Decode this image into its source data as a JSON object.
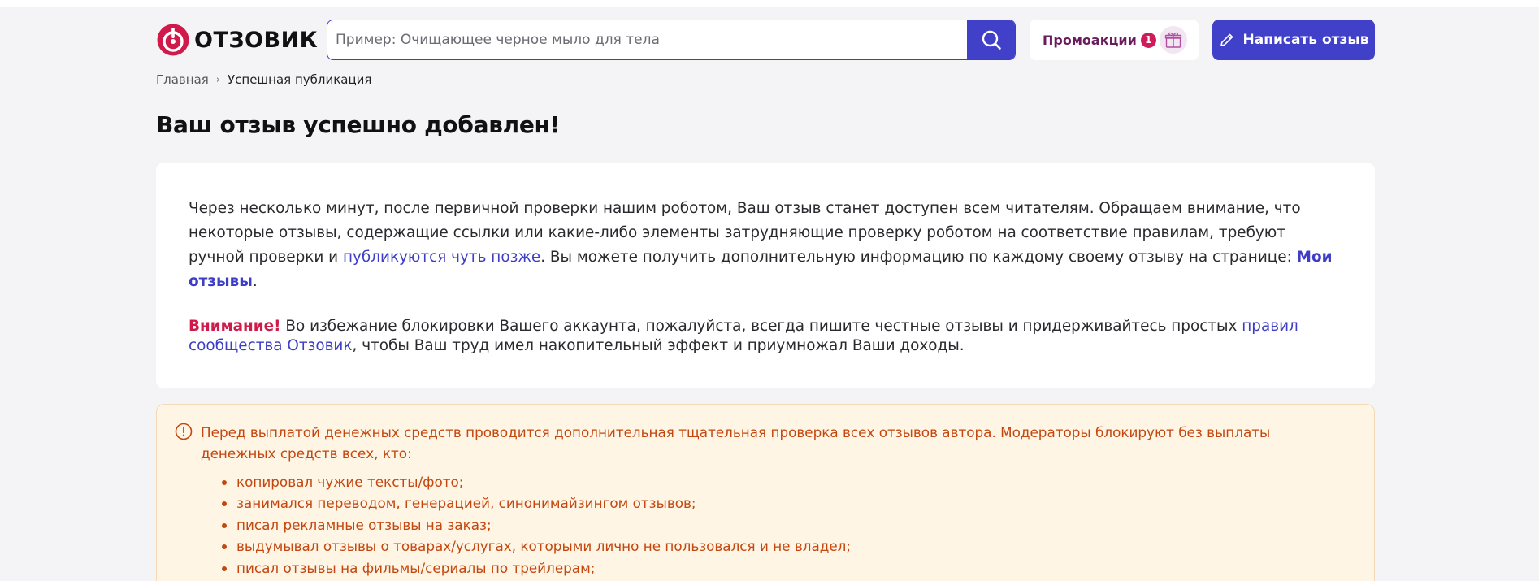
{
  "header": {
    "logo_text": "ОТЗОВИК",
    "search": {
      "placeholder": "Пример: Очищающее черное мыло для тела",
      "value": ""
    },
    "promo": {
      "label": "Промоакции",
      "badge": "1"
    },
    "write_button": "Написать отзыв",
    "colors": {
      "brand": "#d01b4a",
      "accent": "#4040c8"
    }
  },
  "breadcrumb": {
    "home": "Главная",
    "separator": "›",
    "current": "Успешная публикация"
  },
  "page_title": "Ваш отзыв успешно добавлен!",
  "success_card": {
    "intro": "Через несколько минут, после первичной проверки нашим роботом, Ваш отзыв станет доступен всем читателям. Обращаем внимание, что некоторые отзывы, содержащие ссылки или какие-либо элементы затрудняющие проверку роботом на соответствие правилам, требуют ручной проверки и ",
    "later_link": "публикуются чуть позже",
    "more_info": ". Вы можете получить дополнительную информацию по каждому своему отзыву на странице: ",
    "my_reviews_link": "Мои отзывы",
    "period": ".",
    "attention_label": "Внимание!",
    "attention_text": " Во избежание блокировки Вашего аккаунта, пожалуйста, всегда пишите честные отзывы и придерживайтесь простых ",
    "rules_link": "правил сообщества Отзовик",
    "attention_tail": ", чтобы Ваш труд имел накопительный эффект и приумножал Ваши доходы."
  },
  "notice": {
    "icon": "exclamation-circle-icon",
    "text": "Перед выплатой денежных средств проводится дополнительная тщательная проверка всех отзывов автора. Модераторы блокируют без выплаты денежных средств всех, кто:",
    "items": [
      "копировал чужие тексты/фото;",
      "занимался переводом, генерацией, синонимайзингом отзывов;",
      "писал рекламные отзывы на заказ;",
      "выдумывал отзывы о товарах/услугах, которыми лично не пользовался и не владел;",
      "писал отзывы на фильмы/сериалы по трейлерам;"
    ]
  }
}
